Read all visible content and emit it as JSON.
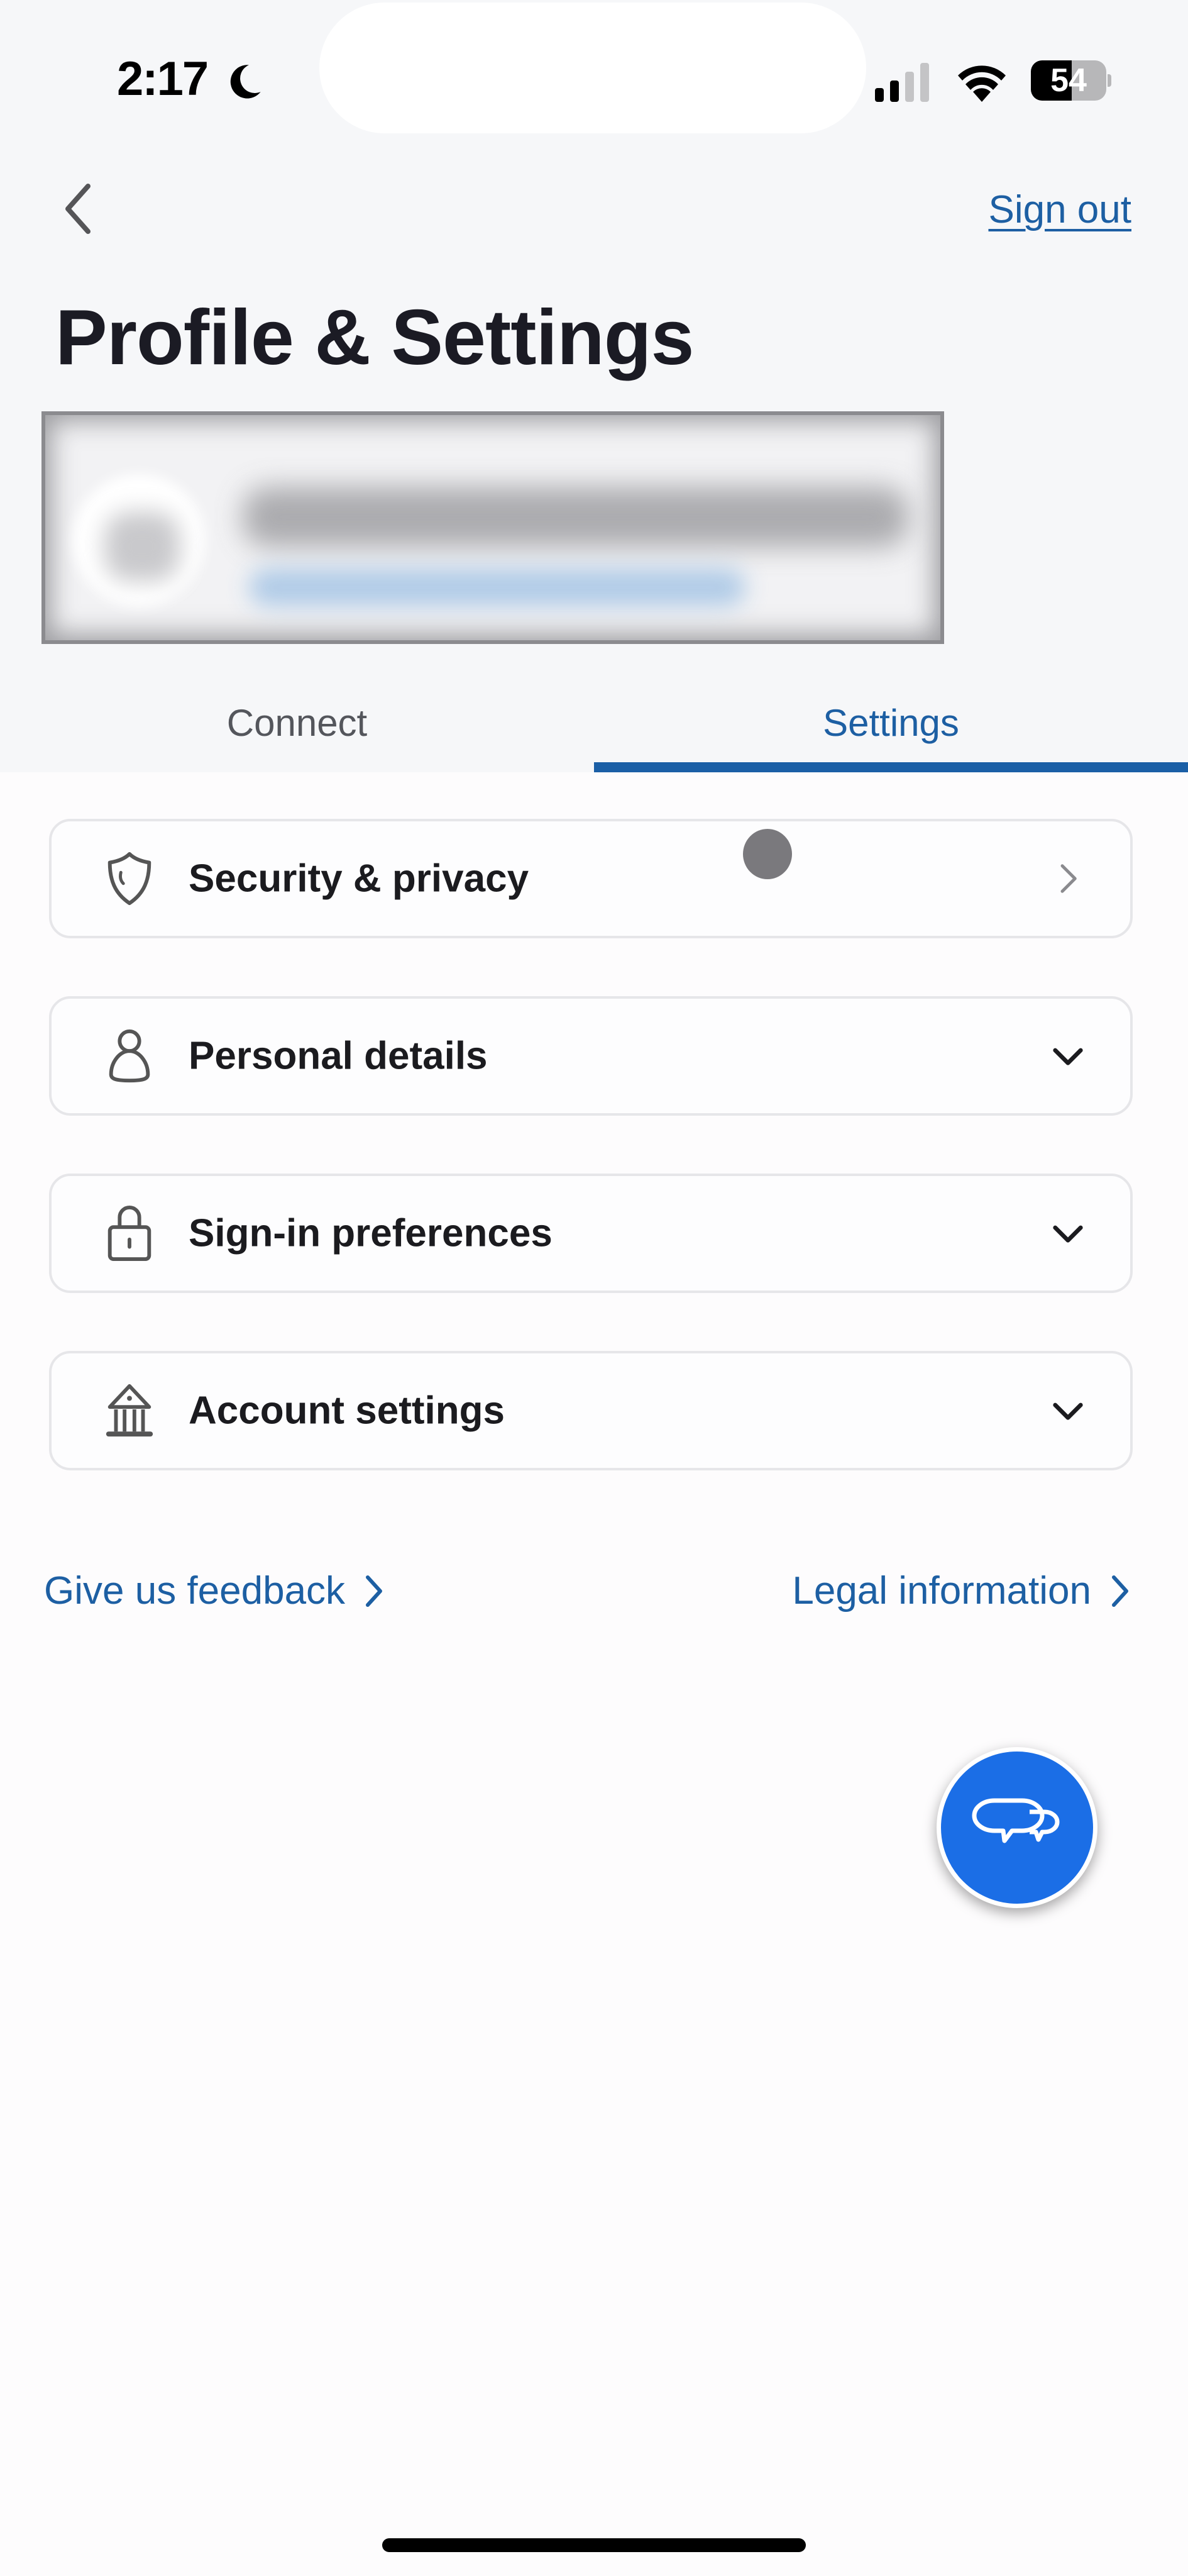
{
  "status_bar": {
    "time": "2:17",
    "focus_mode_icon": "moon-icon",
    "signal_bars_active": 2,
    "signal_bars_total": 4,
    "wifi_icon": "wifi-icon",
    "battery_percent": 54,
    "battery_label": "54"
  },
  "nav": {
    "back_icon": "chevron-left-icon",
    "sign_out_label": "Sign out"
  },
  "header": {
    "title": "Profile & Settings"
  },
  "profile": {
    "redacted": true,
    "note": "profile name and subtitle blurred"
  },
  "tabs": [
    {
      "label": "Connect",
      "selected": false
    },
    {
      "label": "Settings",
      "selected": true
    }
  ],
  "settings": {
    "items": [
      {
        "label": "Security & privacy",
        "icon": "shield-icon",
        "action_icon": "chevron-right-icon"
      },
      {
        "label": "Personal details",
        "icon": "person-icon",
        "action_icon": "chevron-down-icon"
      },
      {
        "label": "Sign-in preferences",
        "icon": "lock-icon",
        "action_icon": "chevron-down-icon"
      },
      {
        "label": "Account settings",
        "icon": "bank-icon",
        "action_icon": "chevron-down-icon"
      }
    ]
  },
  "footer": {
    "feedback_label": "Give us feedback",
    "legal_label": "Legal information"
  },
  "chat": {
    "icon": "chat-bubbles-icon"
  },
  "colors": {
    "accent": "#1d5fa3",
    "tab_indicator": "#1b5fa6",
    "chat_fab": "#1b6ee6",
    "header_background": "#f6f7f9",
    "page_background": "#fdfcfd"
  }
}
